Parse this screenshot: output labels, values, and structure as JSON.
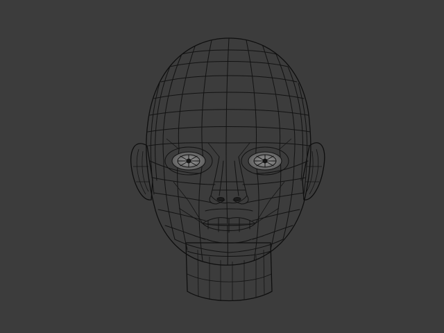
{
  "scene": {
    "background_color": "#3c3c3c",
    "mesh_base_color": "#8e8e8e",
    "mesh_highlight_color": "#b4b4b4",
    "mesh_shadow_color": "#3a3a3a",
    "wire_color": "#121212"
  }
}
